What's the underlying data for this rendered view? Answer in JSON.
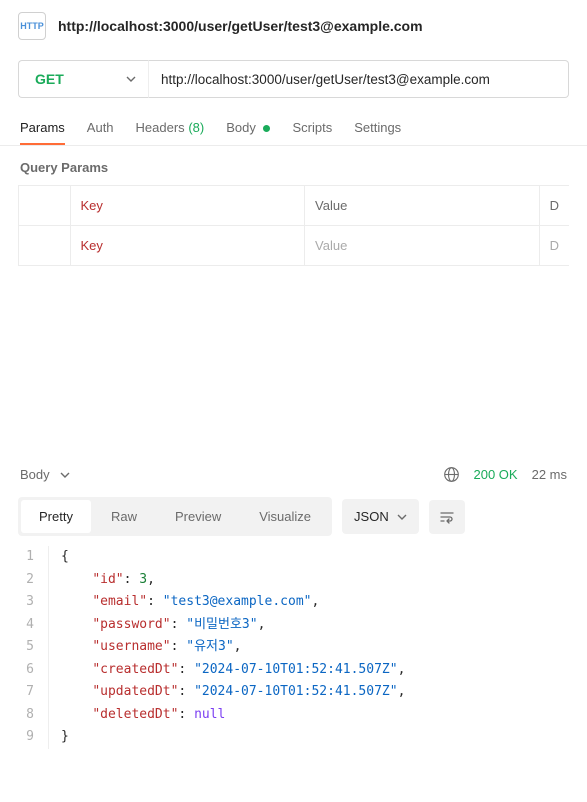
{
  "header": {
    "icon_label": "HTTP",
    "title": "http://localhost:3000/user/getUser/test3@example.com"
  },
  "request": {
    "method": "GET",
    "url": "http://localhost:3000/user/getUser/test3@example.com"
  },
  "tabs": {
    "params": "Params",
    "auth": "Auth",
    "headers_label": "Headers",
    "headers_count": "(8)",
    "body": "Body",
    "scripts": "Scripts",
    "settings": "Settings"
  },
  "params": {
    "section_title": "Query Params",
    "columns": {
      "key": "Key",
      "value": "Value",
      "desc": "D"
    },
    "placeholders": {
      "key": "Key",
      "value": "Value",
      "desc": "D"
    }
  },
  "response": {
    "label": "Body",
    "status": "200 OK",
    "time": "22 ms",
    "viewtabs": {
      "pretty": "Pretty",
      "raw": "Raw",
      "preview": "Preview",
      "visualize": "Visualize"
    },
    "format": "JSON",
    "lines": [
      {
        "n": "1",
        "tokens": [
          {
            "t": "br",
            "v": "{"
          }
        ]
      },
      {
        "n": "2",
        "tokens": [
          {
            "t": "pu",
            "v": "    "
          },
          {
            "t": "key",
            "v": "\"id\""
          },
          {
            "t": "pu",
            "v": ": "
          },
          {
            "t": "num",
            "v": "3"
          },
          {
            "t": "pu",
            "v": ","
          }
        ]
      },
      {
        "n": "3",
        "tokens": [
          {
            "t": "pu",
            "v": "    "
          },
          {
            "t": "key",
            "v": "\"email\""
          },
          {
            "t": "pu",
            "v": ": "
          },
          {
            "t": "str",
            "v": "\"test3@example.com\""
          },
          {
            "t": "pu",
            "v": ","
          }
        ]
      },
      {
        "n": "4",
        "tokens": [
          {
            "t": "pu",
            "v": "    "
          },
          {
            "t": "key",
            "v": "\"password\""
          },
          {
            "t": "pu",
            "v": ": "
          },
          {
            "t": "str",
            "v": "\"비밀번호3\""
          },
          {
            "t": "pu",
            "v": ","
          }
        ]
      },
      {
        "n": "5",
        "tokens": [
          {
            "t": "pu",
            "v": "    "
          },
          {
            "t": "key",
            "v": "\"username\""
          },
          {
            "t": "pu",
            "v": ": "
          },
          {
            "t": "str",
            "v": "\"유저3\""
          },
          {
            "t": "pu",
            "v": ","
          }
        ]
      },
      {
        "n": "6",
        "tokens": [
          {
            "t": "pu",
            "v": "    "
          },
          {
            "t": "key",
            "v": "\"createdDt\""
          },
          {
            "t": "pu",
            "v": ": "
          },
          {
            "t": "str",
            "v": "\"2024-07-10T01:52:41.507Z\""
          },
          {
            "t": "pu",
            "v": ","
          }
        ]
      },
      {
        "n": "7",
        "tokens": [
          {
            "t": "pu",
            "v": "    "
          },
          {
            "t": "key",
            "v": "\"updatedDt\""
          },
          {
            "t": "pu",
            "v": ": "
          },
          {
            "t": "str",
            "v": "\"2024-07-10T01:52:41.507Z\""
          },
          {
            "t": "pu",
            "v": ","
          }
        ]
      },
      {
        "n": "8",
        "tokens": [
          {
            "t": "pu",
            "v": "    "
          },
          {
            "t": "key",
            "v": "\"deletedDt\""
          },
          {
            "t": "pu",
            "v": ": "
          },
          {
            "t": "nul",
            "v": "null"
          }
        ]
      },
      {
        "n": "9",
        "tokens": [
          {
            "t": "br",
            "v": "}"
          }
        ]
      }
    ]
  }
}
